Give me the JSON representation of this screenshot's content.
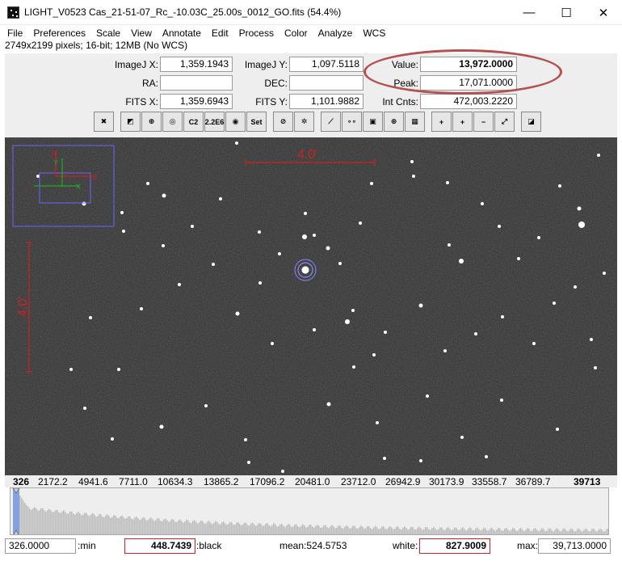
{
  "window": {
    "title": "LIGHT_V0523 Cas_21-51-07_Rc_-10.03C_25.00s_0012_GO.fits (54.4%)",
    "minimize_glyph": "—",
    "maximize_glyph": "☐",
    "close_glyph": "✕"
  },
  "menu": [
    "File",
    "Preferences",
    "Scale",
    "View",
    "Annotate",
    "Edit",
    "Process",
    "Color",
    "Analyze",
    "WCS"
  ],
  "image_info": "2749x2199 pixels; 16-bit; 12MB (No WCS)",
  "coords": {
    "imagej_x_label": "ImageJ X:",
    "imagej_x": "1,359.1943",
    "imagej_y_label": "ImageJ Y:",
    "imagej_y": "1,097.5118",
    "value_label": "Value:",
    "value": "13,972.0000",
    "ra_label": "RA:",
    "ra": "",
    "dec_label": "DEC:",
    "dec": "",
    "peak_label": "Peak:",
    "peak": "17,071.0000",
    "fits_x_label": "FITS X:",
    "fits_x": "1,359.6943",
    "fits_y_label": "FITS Y:",
    "fits_y": "1,101.9882",
    "intcnts_label": "Int Cnts:",
    "intcnts": "472,003.2220"
  },
  "toolbar": {
    "buttons": [
      {
        "name": "clear-overlay-icon",
        "glyph": "✖"
      },
      {
        "name": "invert-icon",
        "glyph": "◩"
      },
      {
        "name": "name-star-icon",
        "glyph": "⊕"
      },
      {
        "name": "aperture-icon",
        "glyph": "◎"
      },
      {
        "name": "centroid-c2-icon",
        "glyph": "C2"
      },
      {
        "name": "aperture-2-2e6-icon",
        "glyph": "2.2E6"
      },
      {
        "name": "aperture-ring-icon",
        "glyph": "◉"
      },
      {
        "name": "set-aperture-icon",
        "glyph": "Set"
      },
      {
        "name": "no-aperture-icon",
        "glyph": "⊘"
      },
      {
        "name": "multi-aperture-icon",
        "glyph": "✲"
      },
      {
        "name": "measure-line-icon",
        "glyph": "⟋"
      },
      {
        "name": "compare-stars-icon",
        "glyph": "∘∘"
      },
      {
        "name": "stack-icon",
        "glyph": "▣"
      },
      {
        "name": "crosshair-icon",
        "glyph": "⊕"
      },
      {
        "name": "table-icon",
        "glyph": "▦"
      },
      {
        "name": "zoom-in-icon",
        "glyph": "+"
      },
      {
        "name": "zoom-in-fine-icon",
        "glyph": "+"
      },
      {
        "name": "zoom-out-icon",
        "glyph": "−"
      },
      {
        "name": "zoom-fit-icon",
        "glyph": "⤢"
      },
      {
        "name": "contrast-icon",
        "glyph": "◪"
      }
    ]
  },
  "overlays": {
    "horizontal_scale": "4.0'",
    "vertical_scale": "4.0'",
    "compass_n": "N",
    "compass_e": "E",
    "compass_y": "Y",
    "compass_x": "X"
  },
  "histogram_scale": [
    "326",
    "2172.2",
    "4941.6",
    "7711.0",
    "10634.3",
    "13865.2",
    "17096.2",
    "20481.0",
    "23712.0",
    "26942.9",
    "30173.9",
    "33558.7",
    "36789.7",
    "39713"
  ],
  "bottom": {
    "min_value": "326.0000",
    "min_label": ":min",
    "black_value": "448.7439",
    "black_label": ":black",
    "mean_text": "mean:524.5753",
    "white_label": "white:",
    "white_value": "827.9009",
    "max_label": "max:",
    "max_value": "39,713.0000"
  },
  "colors": {
    "annotation_red": "#cc2222",
    "highlight_ellipse": "#b55050",
    "compass_blue": "#6666ff",
    "histogram_bar": "#bdbdbd",
    "histogram_black_marker": "#7799dd"
  }
}
